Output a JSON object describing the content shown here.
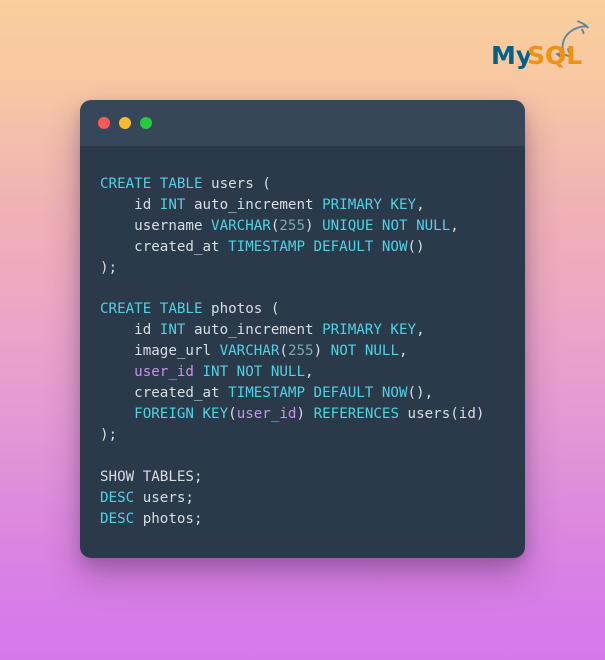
{
  "background": {
    "gradient_from": "#f9cf9b",
    "gradient_mid": "#eba8c4",
    "gradient_to": "#d579ea"
  },
  "logo": {
    "name": "mysql-logo",
    "text_primary": "My",
    "text_secondary": "SQL",
    "color_primary": "#00618a",
    "color_secondary": "#f29111",
    "dolphin_color": "#5d87a1"
  },
  "window": {
    "title_bar_color": "#37475a",
    "body_color": "#2b3a4a",
    "traffic_lights": [
      {
        "name": "close",
        "color": "#fa5c55"
      },
      {
        "name": "minimize",
        "color": "#f9bb2e"
      },
      {
        "name": "maximize",
        "color": "#27c93f"
      }
    ]
  },
  "editor": {
    "language": "sql",
    "colors": {
      "keyword": "#4fd2e3",
      "identifier": "#d7dde4",
      "variable": "#c792ea",
      "number": "#79a8b4"
    },
    "lines": [
      [
        {
          "t": "CREATE TABLE",
          "c": "kw"
        },
        {
          "t": " users (",
          "c": "id"
        }
      ],
      [
        {
          "t": "    id ",
          "c": "id"
        },
        {
          "t": "INT",
          "c": "kw"
        },
        {
          "t": " auto_increment ",
          "c": "id"
        },
        {
          "t": "PRIMARY KEY",
          "c": "kw"
        },
        {
          "t": ",",
          "c": "id"
        }
      ],
      [
        {
          "t": "    username ",
          "c": "id"
        },
        {
          "t": "VARCHAR",
          "c": "kw"
        },
        {
          "t": "(",
          "c": "id"
        },
        {
          "t": "255",
          "c": "num"
        },
        {
          "t": ") ",
          "c": "id"
        },
        {
          "t": "UNIQUE NOT NULL",
          "c": "kw"
        },
        {
          "t": ",",
          "c": "id"
        }
      ],
      [
        {
          "t": "    created_at ",
          "c": "id"
        },
        {
          "t": "TIMESTAMP DEFAULT NOW",
          "c": "kw"
        },
        {
          "t": "()",
          "c": "id"
        }
      ],
      [
        {
          "t": ");",
          "c": "id"
        }
      ],
      [
        {
          "t": "",
          "c": "id"
        }
      ],
      [
        {
          "t": "CREATE TABLE",
          "c": "kw"
        },
        {
          "t": " photos (",
          "c": "id"
        }
      ],
      [
        {
          "t": "    id ",
          "c": "id"
        },
        {
          "t": "INT",
          "c": "kw"
        },
        {
          "t": " auto_increment ",
          "c": "id"
        },
        {
          "t": "PRIMARY KEY",
          "c": "kw"
        },
        {
          "t": ",",
          "c": "id"
        }
      ],
      [
        {
          "t": "    image_url ",
          "c": "id"
        },
        {
          "t": "VARCHAR",
          "c": "kw"
        },
        {
          "t": "(",
          "c": "id"
        },
        {
          "t": "255",
          "c": "num"
        },
        {
          "t": ") ",
          "c": "id"
        },
        {
          "t": "NOT NULL",
          "c": "kw"
        },
        {
          "t": ",",
          "c": "id"
        }
      ],
      [
        {
          "t": "    ",
          "c": "id"
        },
        {
          "t": "user_id",
          "c": "var"
        },
        {
          "t": " ",
          "c": "id"
        },
        {
          "t": "INT NOT NULL",
          "c": "kw"
        },
        {
          "t": ",",
          "c": "id"
        }
      ],
      [
        {
          "t": "    created_at ",
          "c": "id"
        },
        {
          "t": "TIMESTAMP DEFAULT NOW",
          "c": "kw"
        },
        {
          "t": "(),",
          "c": "id"
        }
      ],
      [
        {
          "t": "    ",
          "c": "id"
        },
        {
          "t": "FOREIGN KEY",
          "c": "kw"
        },
        {
          "t": "(",
          "c": "id"
        },
        {
          "t": "user_id",
          "c": "var"
        },
        {
          "t": ") ",
          "c": "id"
        },
        {
          "t": "REFERENCES",
          "c": "kw"
        },
        {
          "t": " users(id)",
          "c": "id"
        }
      ],
      [
        {
          "t": ");",
          "c": "id"
        }
      ],
      [
        {
          "t": "",
          "c": "id"
        }
      ],
      [
        {
          "t": "SHOW TABLES;",
          "c": "id"
        }
      ],
      [
        {
          "t": "DESC",
          "c": "kw"
        },
        {
          "t": " users;",
          "c": "id"
        }
      ],
      [
        {
          "t": "DESC",
          "c": "kw"
        },
        {
          "t": " photos;",
          "c": "id"
        }
      ]
    ]
  }
}
